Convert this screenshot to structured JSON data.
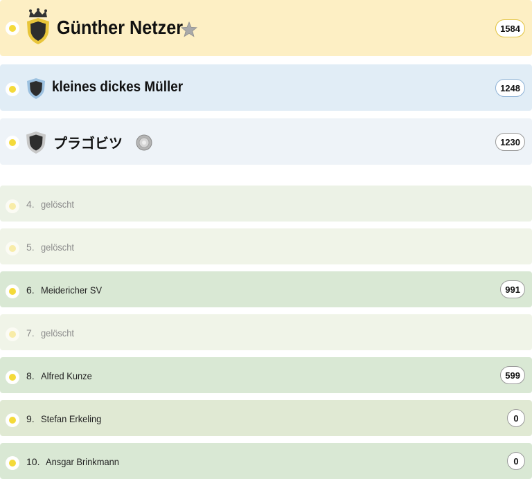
{
  "podium": [
    {
      "name": "Günther Netzer",
      "score": "1584",
      "shield": "gold-shield-icon",
      "crown": "crown-icon",
      "badge": "star-icon"
    },
    {
      "name": "kleines dickes Müller",
      "score": "1248",
      "shield": "silver-blue-shield-icon"
    },
    {
      "name": "プラゴビツ",
      "score": "1230",
      "shield": "gray-shield-icon",
      "badge": "coin-badge-icon"
    }
  ],
  "rows": [
    {
      "rank": "4.",
      "name": "gelöscht",
      "score": ""
    },
    {
      "rank": "5.",
      "name": "gelöscht",
      "score": ""
    },
    {
      "rank": "6.",
      "name": "Meidericher SV",
      "score": "991"
    },
    {
      "rank": "7.",
      "name": "gelöscht",
      "score": ""
    },
    {
      "rank": "8.",
      "name": "Alfred Kunze",
      "score": "599"
    },
    {
      "rank": "9.",
      "name": "Stefan Erkeling",
      "score": "0"
    },
    {
      "rank": "10.",
      "name": "Ansgar Brinkmann",
      "score": "0"
    }
  ],
  "colors": {
    "first_bg": "#fdefc4",
    "second_bg": "#e1edf6",
    "third_bg": "#eef3f8",
    "row_light": "#ecf2e6",
    "row_faded": "#f0f4e8",
    "row_green": "#d9e8d4",
    "row_mid": "#e0e9d3",
    "accent_yellow": "#f4da3a"
  }
}
